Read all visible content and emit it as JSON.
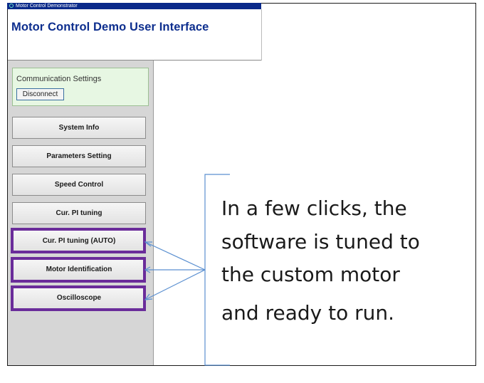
{
  "window": {
    "title": "Motor Control Demonstrator"
  },
  "app": {
    "title": "Motor Control Demo User Interface"
  },
  "communication": {
    "label": "Communication Settings",
    "disconnect_label": "Disconnect"
  },
  "nav": {
    "items": [
      {
        "label": "System Info"
      },
      {
        "label": "Parameters Setting"
      },
      {
        "label": "Speed Control"
      },
      {
        "label": "Cur. PI tuning"
      },
      {
        "label": "Cur. PI tuning (AUTO)"
      },
      {
        "label": "Motor Identification"
      },
      {
        "label": "Oscilloscope"
      }
    ]
  },
  "callout": {
    "lines": [
      "In a few clicks, the",
      "software is tuned to",
      "the custom motor",
      "and ready to run."
    ]
  },
  "colors": {
    "highlight": "#6a2c9a",
    "title_blue": "#0d2e8e",
    "arrow_blue": "#5a8fd0",
    "titlebar": "#0a2a8a"
  }
}
